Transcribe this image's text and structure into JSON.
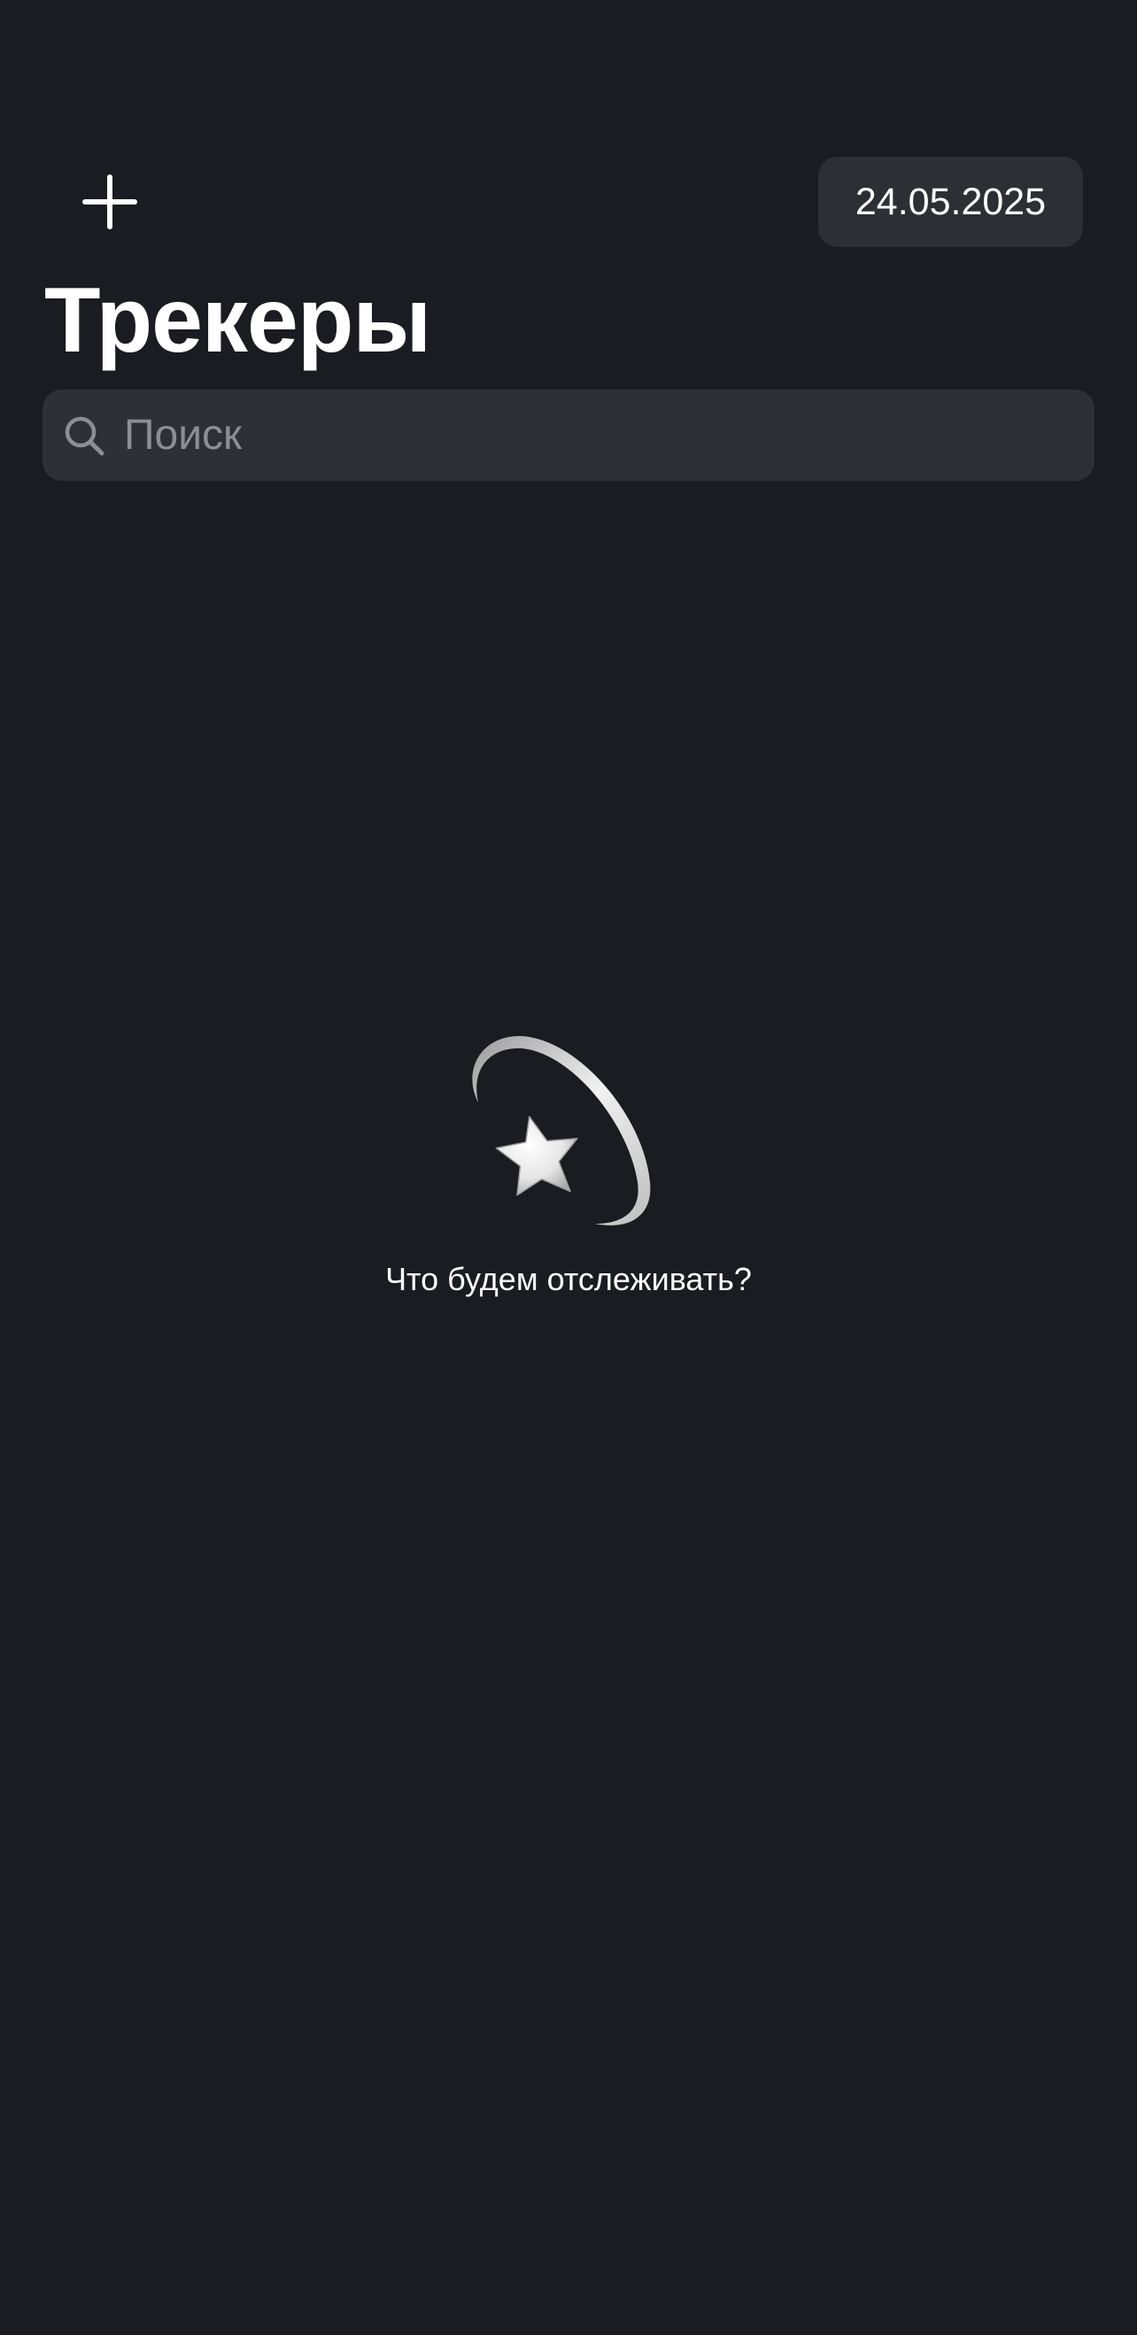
{
  "header": {
    "add_icon": "plus-icon",
    "date_label": "24.05.2025"
  },
  "title": "Трекеры",
  "search": {
    "icon": "magnifier-icon",
    "placeholder": "Поиск",
    "value": ""
  },
  "empty_state": {
    "illustration": "shooting-star-icon",
    "message": "Что будем отслеживать?"
  },
  "colors": {
    "background": "#1b1b22",
    "surface": "#2e2e35",
    "text_primary": "#ffffff",
    "text_secondary": "#8d8d96"
  }
}
